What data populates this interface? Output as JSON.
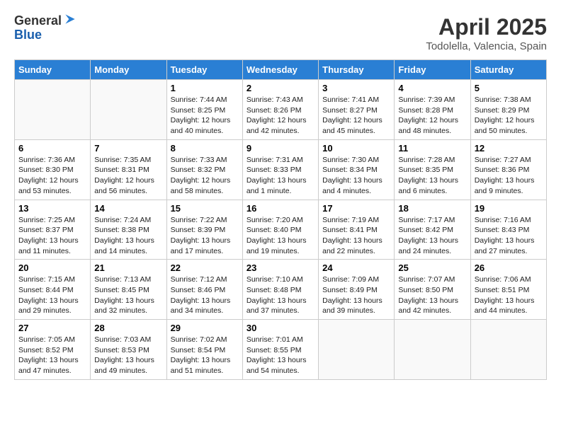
{
  "logo": {
    "general": "General",
    "blue": "Blue"
  },
  "title": "April 2025",
  "subtitle": "Todolella, Valencia, Spain",
  "days_of_week": [
    "Sunday",
    "Monday",
    "Tuesday",
    "Wednesday",
    "Thursday",
    "Friday",
    "Saturday"
  ],
  "weeks": [
    [
      {
        "day": "",
        "content": ""
      },
      {
        "day": "",
        "content": ""
      },
      {
        "day": "1",
        "content": "Sunrise: 7:44 AM\nSunset: 8:25 PM\nDaylight: 12 hours and 40 minutes."
      },
      {
        "day": "2",
        "content": "Sunrise: 7:43 AM\nSunset: 8:26 PM\nDaylight: 12 hours and 42 minutes."
      },
      {
        "day": "3",
        "content": "Sunrise: 7:41 AM\nSunset: 8:27 PM\nDaylight: 12 hours and 45 minutes."
      },
      {
        "day": "4",
        "content": "Sunrise: 7:39 AM\nSunset: 8:28 PM\nDaylight: 12 hours and 48 minutes."
      },
      {
        "day": "5",
        "content": "Sunrise: 7:38 AM\nSunset: 8:29 PM\nDaylight: 12 hours and 50 minutes."
      }
    ],
    [
      {
        "day": "6",
        "content": "Sunrise: 7:36 AM\nSunset: 8:30 PM\nDaylight: 12 hours and 53 minutes."
      },
      {
        "day": "7",
        "content": "Sunrise: 7:35 AM\nSunset: 8:31 PM\nDaylight: 12 hours and 56 minutes."
      },
      {
        "day": "8",
        "content": "Sunrise: 7:33 AM\nSunset: 8:32 PM\nDaylight: 12 hours and 58 minutes."
      },
      {
        "day": "9",
        "content": "Sunrise: 7:31 AM\nSunset: 8:33 PM\nDaylight: 13 hours and 1 minute."
      },
      {
        "day": "10",
        "content": "Sunrise: 7:30 AM\nSunset: 8:34 PM\nDaylight: 13 hours and 4 minutes."
      },
      {
        "day": "11",
        "content": "Sunrise: 7:28 AM\nSunset: 8:35 PM\nDaylight: 13 hours and 6 minutes."
      },
      {
        "day": "12",
        "content": "Sunrise: 7:27 AM\nSunset: 8:36 PM\nDaylight: 13 hours and 9 minutes."
      }
    ],
    [
      {
        "day": "13",
        "content": "Sunrise: 7:25 AM\nSunset: 8:37 PM\nDaylight: 13 hours and 11 minutes."
      },
      {
        "day": "14",
        "content": "Sunrise: 7:24 AM\nSunset: 8:38 PM\nDaylight: 13 hours and 14 minutes."
      },
      {
        "day": "15",
        "content": "Sunrise: 7:22 AM\nSunset: 8:39 PM\nDaylight: 13 hours and 17 minutes."
      },
      {
        "day": "16",
        "content": "Sunrise: 7:20 AM\nSunset: 8:40 PM\nDaylight: 13 hours and 19 minutes."
      },
      {
        "day": "17",
        "content": "Sunrise: 7:19 AM\nSunset: 8:41 PM\nDaylight: 13 hours and 22 minutes."
      },
      {
        "day": "18",
        "content": "Sunrise: 7:17 AM\nSunset: 8:42 PM\nDaylight: 13 hours and 24 minutes."
      },
      {
        "day": "19",
        "content": "Sunrise: 7:16 AM\nSunset: 8:43 PM\nDaylight: 13 hours and 27 minutes."
      }
    ],
    [
      {
        "day": "20",
        "content": "Sunrise: 7:15 AM\nSunset: 8:44 PM\nDaylight: 13 hours and 29 minutes."
      },
      {
        "day": "21",
        "content": "Sunrise: 7:13 AM\nSunset: 8:45 PM\nDaylight: 13 hours and 32 minutes."
      },
      {
        "day": "22",
        "content": "Sunrise: 7:12 AM\nSunset: 8:46 PM\nDaylight: 13 hours and 34 minutes."
      },
      {
        "day": "23",
        "content": "Sunrise: 7:10 AM\nSunset: 8:48 PM\nDaylight: 13 hours and 37 minutes."
      },
      {
        "day": "24",
        "content": "Sunrise: 7:09 AM\nSunset: 8:49 PM\nDaylight: 13 hours and 39 minutes."
      },
      {
        "day": "25",
        "content": "Sunrise: 7:07 AM\nSunset: 8:50 PM\nDaylight: 13 hours and 42 minutes."
      },
      {
        "day": "26",
        "content": "Sunrise: 7:06 AM\nSunset: 8:51 PM\nDaylight: 13 hours and 44 minutes."
      }
    ],
    [
      {
        "day": "27",
        "content": "Sunrise: 7:05 AM\nSunset: 8:52 PM\nDaylight: 13 hours and 47 minutes."
      },
      {
        "day": "28",
        "content": "Sunrise: 7:03 AM\nSunset: 8:53 PM\nDaylight: 13 hours and 49 minutes."
      },
      {
        "day": "29",
        "content": "Sunrise: 7:02 AM\nSunset: 8:54 PM\nDaylight: 13 hours and 51 minutes."
      },
      {
        "day": "30",
        "content": "Sunrise: 7:01 AM\nSunset: 8:55 PM\nDaylight: 13 hours and 54 minutes."
      },
      {
        "day": "",
        "content": ""
      },
      {
        "day": "",
        "content": ""
      },
      {
        "day": "",
        "content": ""
      }
    ]
  ]
}
